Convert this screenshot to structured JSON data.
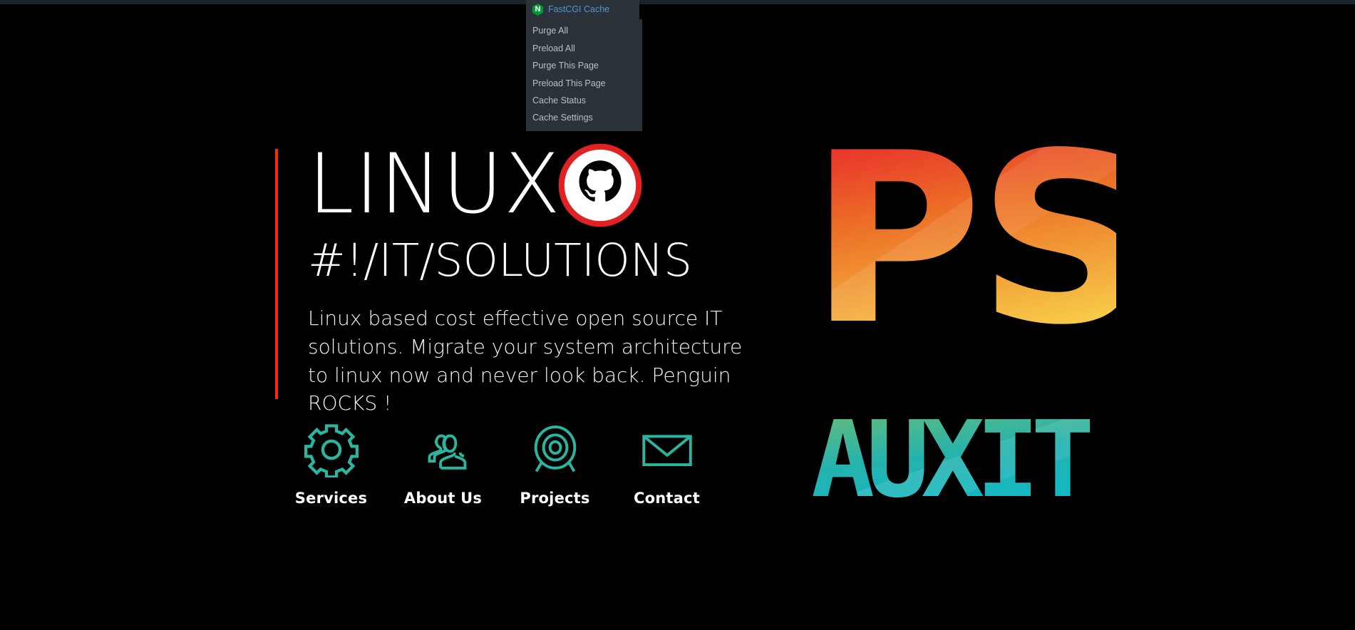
{
  "admin_bar": {
    "fastcgi_menu": {
      "icon": "nginx-logo-icon",
      "logo_letter": "N",
      "title": "FastCGI Cache",
      "title_color": "#4f94d4",
      "background": "#2c3338",
      "items": [
        {
          "label": "Purge All"
        },
        {
          "label": "Preload All"
        },
        {
          "label": "Purge This Page"
        },
        {
          "label": "Preload This Page"
        },
        {
          "label": "Cache Status"
        },
        {
          "label": "Cache Settings"
        }
      ]
    }
  },
  "hero": {
    "accent_color": "#fb2a10",
    "brand_name": "LINUX",
    "brand_icon": "github-octocat-icon",
    "subtitle": "#!/IT/SOLUTIONS",
    "paragraph": "Linux based cost effective open source IT solutions. Migrate your system architecture to linux now and never look back. Penguin ROCKS !"
  },
  "features": [
    {
      "icon": "gear-icon",
      "label": "Services"
    },
    {
      "icon": "people-icon",
      "label": "About Us"
    },
    {
      "icon": "target-icon",
      "label": "Projects"
    },
    {
      "icon": "envelope-icon",
      "label": "Contact"
    }
  ],
  "feature_icon_color": "#2bb5a0",
  "brand_graphic": {
    "ps_text": "PS",
    "ps_gradient_from": "#e8212e",
    "ps_gradient_to": "#f6c84a",
    "auxit_text": "AUXIT",
    "auxit_gradient_from": "#6cbe76",
    "auxit_gradient_to": "#17b6bd"
  },
  "background_color": "#000000"
}
